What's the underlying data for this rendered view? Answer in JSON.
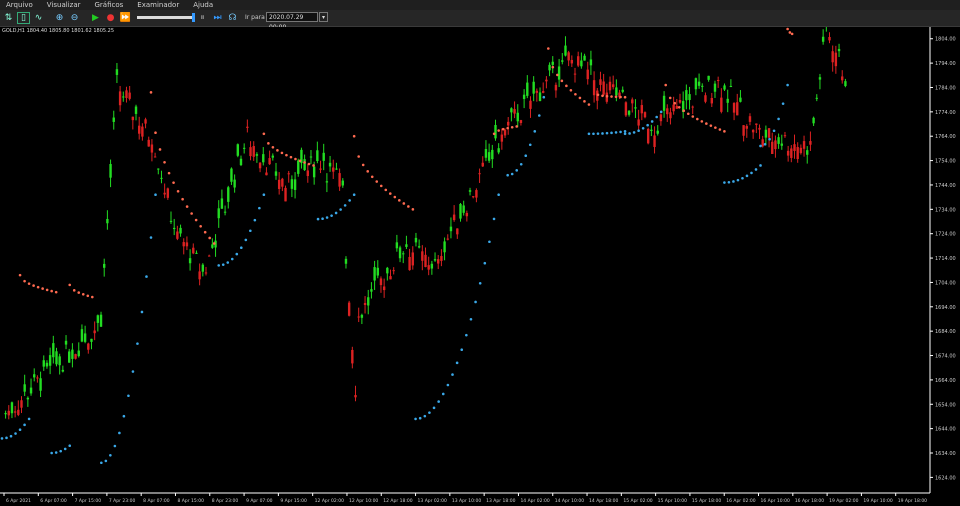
{
  "menu": [
    "Arquivo",
    "Visualizar",
    "Gráficos",
    "Examinador",
    "Ajuda"
  ],
  "toolbar": {
    "icons": [
      "chart-type-icon",
      "chart-zoom-box-icon",
      "line-chart-icon",
      "zoom-in-icon",
      "zoom-out-icon",
      "play-icon",
      "stop-icon",
      "step-icon",
      "pause-icon",
      "skip-icon",
      "headset-icon"
    ],
    "goto_label": "Ir para",
    "date_value": "2020.07.29 00:00"
  },
  "colors": {
    "bull": "#22dd22",
    "bear": "#dd2222",
    "sar_up": "#3aa8e8",
    "sar_down": "#ff6a50",
    "axis": "#ffffff",
    "background": "#000000"
  },
  "chart_data": {
    "type": "candlestick",
    "symbol_line": "GOLD,H1 1804.40 1805.80 1801.62 1805.25",
    "ylim": [
      1618,
      1808
    ],
    "y_ticks": [
      1804.0,
      1794.0,
      1784.0,
      1774.0,
      1764.0,
      1754.0,
      1744.0,
      1734.0,
      1724.0,
      1714.0,
      1704.0,
      1694.0,
      1684.0,
      1674.0,
      1664.0,
      1654.0,
      1644.0,
      1634.0,
      1624.0
    ],
    "x_ticks": [
      "6 Apr 2021",
      "6 Apr 07:00",
      "7 Apr 15:00",
      "7 Apr 23:00",
      "8 Apr 07:00",
      "8 Apr 15:00",
      "8 Apr 23:00",
      "9 Apr 07:00",
      "9 Apr 15:00",
      "12 Apr 02:00",
      "12 Apr 10:00",
      "12 Apr 18:00",
      "13 Apr 02:00",
      "13 Apr 10:00",
      "13 Apr 18:00",
      "14 Apr 02:00",
      "14 Apr 10:00",
      "14 Apr 18:00",
      "15 Apr 02:00",
      "15 Apr 10:00",
      "15 Apr 18:00",
      "16 Apr 02:00",
      "16 Apr 10:00",
      "16 Apr 18:00",
      "19 Apr 02:00",
      "19 Apr 10:00",
      "19 Apr 18:00"
    ],
    "segments": [
      {
        "n": 30,
        "start": 1650,
        "end": 1686,
        "dir": 1
      },
      {
        "n": 6,
        "start": 1690,
        "end": 1785,
        "dir": 1
      },
      {
        "n": 10,
        "start": 1783,
        "end": 1765,
        "dir": -1
      },
      {
        "n": 9,
        "start": 1765,
        "end": 1722,
        "dir": -1
      },
      {
        "n": 8,
        "start": 1722,
        "end": 1708,
        "dir": -1
      },
      {
        "n": 14,
        "start": 1710,
        "end": 1764,
        "dir": 1
      },
      {
        "n": 12,
        "start": 1762,
        "end": 1744,
        "dir": -1
      },
      {
        "n": 12,
        "start": 1744,
        "end": 1755,
        "dir": 1
      },
      {
        "n": 6,
        "start": 1750,
        "end": 1745,
        "dir": -1
      },
      {
        "n": 4,
        "start": 1715,
        "end": 1662,
        "dir": -1
      },
      {
        "n": 16,
        "start": 1690,
        "end": 1720,
        "dir": 1
      },
      {
        "n": 10,
        "start": 1718,
        "end": 1710,
        "dir": -1
      },
      {
        "n": 22,
        "start": 1718,
        "end": 1768,
        "dir": 1
      },
      {
        "n": 18,
        "start": 1770,
        "end": 1794,
        "dir": 1
      },
      {
        "n": 14,
        "start": 1796,
        "end": 1782,
        "dir": -1
      },
      {
        "n": 14,
        "start": 1782,
        "end": 1768,
        "dir": -1
      },
      {
        "n": 20,
        "start": 1770,
        "end": 1786,
        "dir": 1
      },
      {
        "n": 14,
        "start": 1784,
        "end": 1764,
        "dir": -1
      },
      {
        "n": 14,
        "start": 1764,
        "end": 1760,
        "dir": -1
      },
      {
        "n": 6,
        "start": 1760,
        "end": 1808,
        "dir": 1
      },
      {
        "n": 6,
        "start": 1806,
        "end": 1788,
        "dir": -1
      }
    ],
    "sar": [
      {
        "x0": 0.0,
        "x1": 0.03,
        "y0": 1640,
        "y1": 1648,
        "side": "up"
      },
      {
        "x0": 0.02,
        "x1": 0.06,
        "y0": 1707,
        "y1": 1700,
        "side": "down"
      },
      {
        "x0": 0.055,
        "x1": 0.075,
        "y0": 1634,
        "y1": 1637,
        "side": "up"
      },
      {
        "x0": 0.075,
        "x1": 0.1,
        "y0": 1703,
        "y1": 1698,
        "side": "down"
      },
      {
        "x0": 0.11,
        "x1": 0.17,
        "y0": 1630,
        "y1": 1740,
        "side": "up"
      },
      {
        "x0": 0.165,
        "x1": 0.235,
        "y0": 1782,
        "y1": 1720,
        "side": "down"
      },
      {
        "x0": 0.24,
        "x1": 0.29,
        "y0": 1711,
        "y1": 1740,
        "side": "up"
      },
      {
        "x0": 0.29,
        "x1": 0.345,
        "y0": 1765,
        "y1": 1752,
        "side": "down"
      },
      {
        "x0": 0.35,
        "x1": 0.39,
        "y0": 1730,
        "y1": 1740,
        "side": "up"
      },
      {
        "x0": 0.39,
        "x1": 0.455,
        "y0": 1764,
        "y1": 1734,
        "side": "down"
      },
      {
        "x0": 0.458,
        "x1": 0.55,
        "y0": 1648,
        "y1": 1740,
        "side": "up"
      },
      {
        "x0": 0.545,
        "x1": 0.57,
        "y0": 1765,
        "y1": 1768,
        "side": "down"
      },
      {
        "x0": 0.56,
        "x1": 0.6,
        "y0": 1748,
        "y1": 1780,
        "side": "up"
      },
      {
        "x0": 0.605,
        "x1": 0.65,
        "y0": 1800,
        "y1": 1777,
        "side": "down"
      },
      {
        "x0": 0.65,
        "x1": 0.69,
        "y0": 1765,
        "y1": 1766,
        "side": "up"
      },
      {
        "x0": 0.66,
        "x1": 0.69,
        "y0": 1781,
        "y1": 1780,
        "side": "down"
      },
      {
        "x0": 0.69,
        "x1": 0.73,
        "y0": 1765,
        "y1": 1774,
        "side": "up"
      },
      {
        "x0": 0.735,
        "x1": 0.8,
        "y0": 1785,
        "y1": 1766,
        "side": "down"
      },
      {
        "x0": 0.8,
        "x1": 0.84,
        "y0": 1745,
        "y1": 1752,
        "side": "up"
      },
      {
        "x0": 0.84,
        "x1": 0.87,
        "y0": 1760,
        "y1": 1785,
        "side": "up"
      },
      {
        "x0": 0.87,
        "x1": 0.875,
        "y0": 1808,
        "y1": 1806,
        "side": "down"
      }
    ],
    "grid": false
  }
}
